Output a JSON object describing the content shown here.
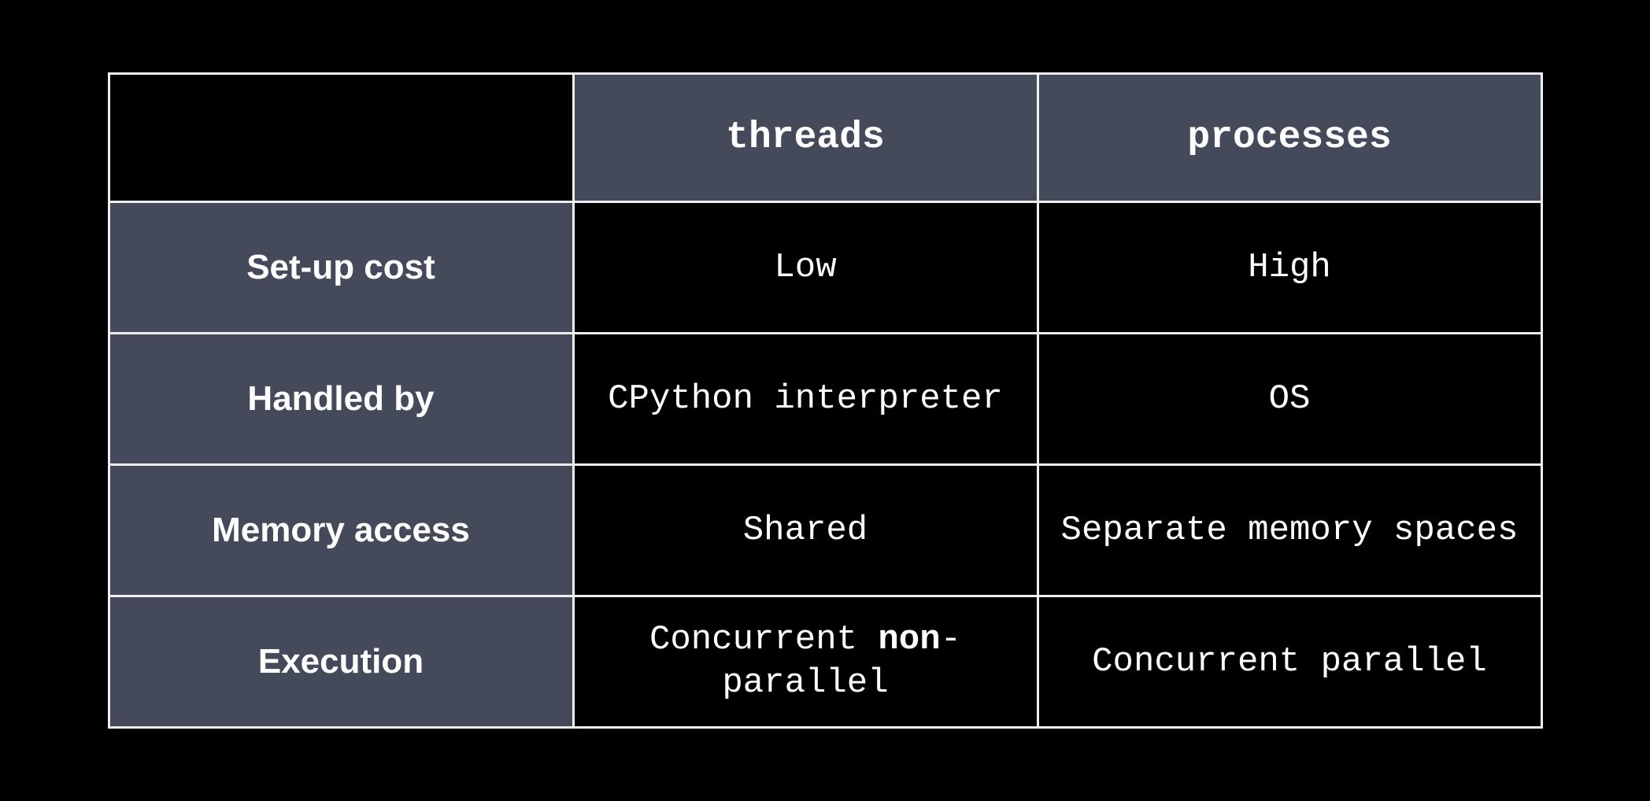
{
  "columns": {
    "threads": "threads",
    "processes": "processes"
  },
  "rows": {
    "setup": {
      "label": "Set-up cost",
      "threads": "Low",
      "processes": "High"
    },
    "handled": {
      "label": "Handled by",
      "threads": "CPython interpreter",
      "processes": "OS"
    },
    "memory": {
      "label": "Memory access",
      "threads": "Shared",
      "processes": "Separate memory spaces"
    },
    "exec": {
      "label": "Execution",
      "threads_pre": "Concurrent ",
      "threads_bold": "non",
      "threads_post": "-parallel",
      "processes": "Concurrent parallel"
    }
  }
}
